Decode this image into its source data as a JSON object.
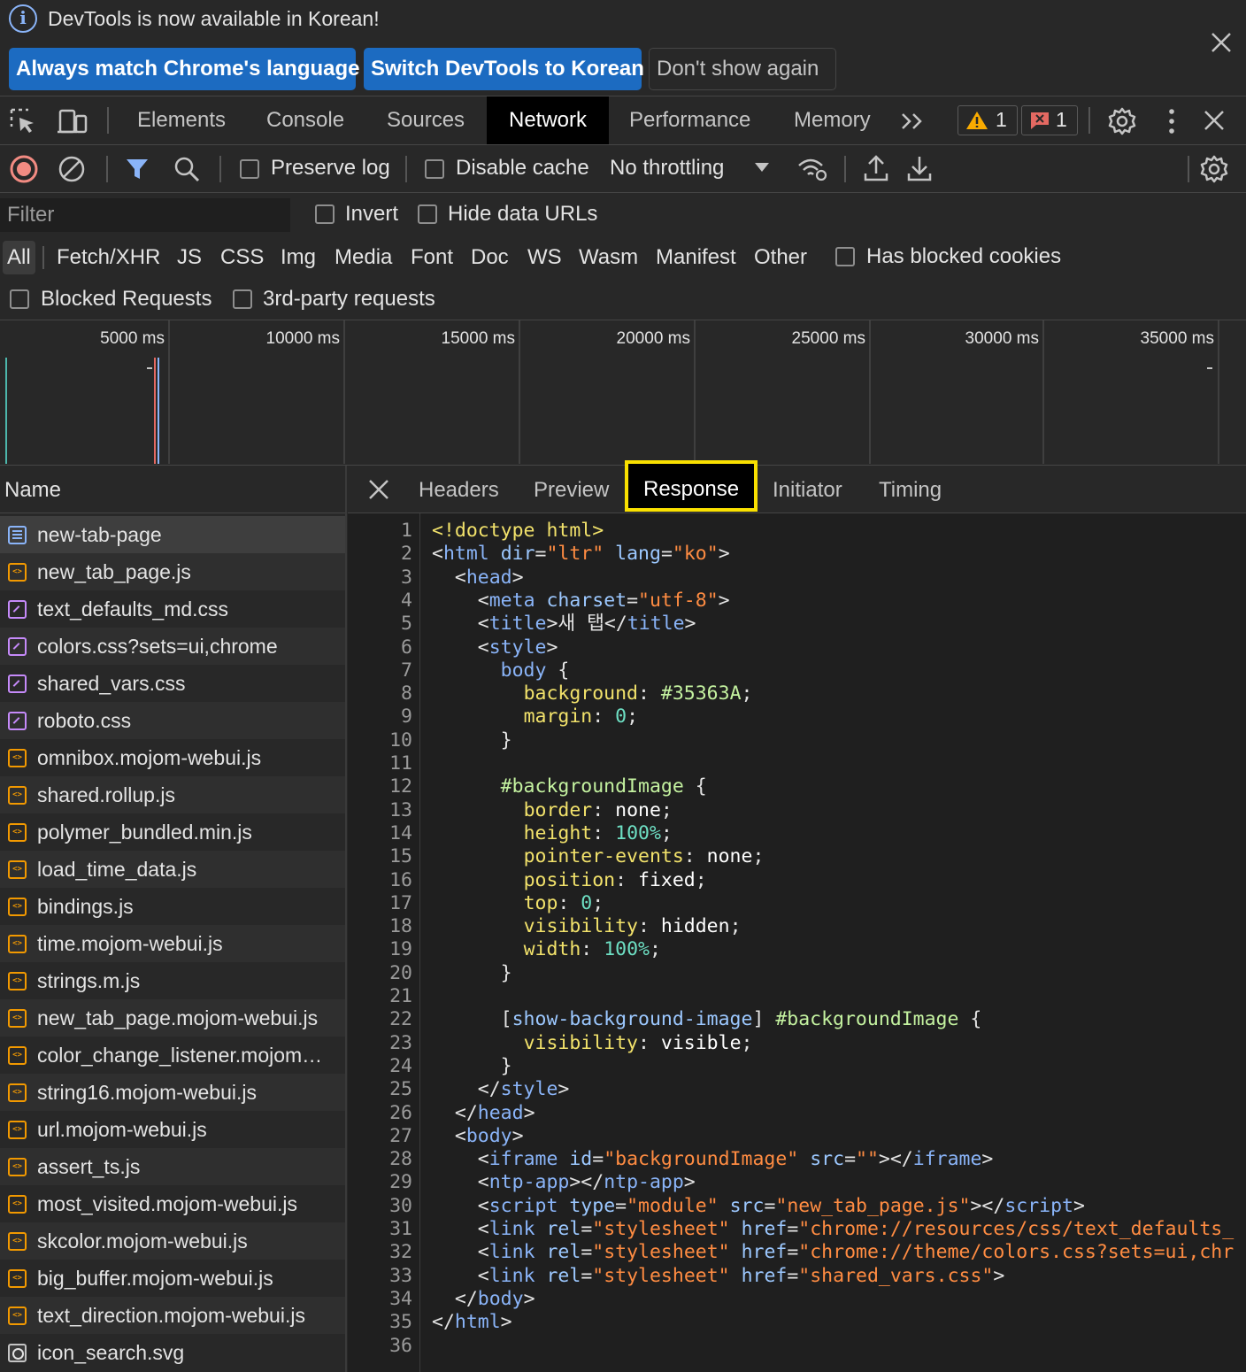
{
  "infobar": {
    "message": "DevTools is now available in Korean!",
    "buttons": [
      "Always match Chrome's language",
      "Switch DevTools to Korean",
      "Don't show again"
    ]
  },
  "main_tabs": [
    "Elements",
    "Console",
    "Sources",
    "Network",
    "Performance",
    "Memory"
  ],
  "active_main_tab": "Network",
  "badges": {
    "warnings": "1",
    "errors": "1"
  },
  "toolbar": {
    "preserve_log": "Preserve log",
    "disable_cache": "Disable cache",
    "throttling": "No throttling"
  },
  "filter": {
    "placeholder": "Filter",
    "invert": "Invert",
    "hide_data_urls": "Hide data URLs",
    "types": [
      "All",
      "Fetch/XHR",
      "JS",
      "CSS",
      "Img",
      "Media",
      "Font",
      "Doc",
      "WS",
      "Wasm",
      "Manifest",
      "Other"
    ],
    "has_blocked_cookies": "Has blocked cookies",
    "blocked_requests": "Blocked Requests",
    "third_party": "3rd-party requests"
  },
  "overview": {
    "ticks": [
      "5000 ms",
      "10000 ms",
      "15000 ms",
      "20000 ms",
      "25000 ms",
      "30000 ms",
      "35000 ms"
    ]
  },
  "requests": {
    "header": "Name",
    "items": [
      {
        "name": "new-tab-page",
        "type": "doc"
      },
      {
        "name": "new_tab_page.js",
        "type": "js"
      },
      {
        "name": "text_defaults_md.css",
        "type": "css"
      },
      {
        "name": "colors.css?sets=ui,chrome",
        "type": "css"
      },
      {
        "name": "shared_vars.css",
        "type": "css"
      },
      {
        "name": "roboto.css",
        "type": "css"
      },
      {
        "name": "omnibox.mojom-webui.js",
        "type": "js"
      },
      {
        "name": "shared.rollup.js",
        "type": "js"
      },
      {
        "name": "polymer_bundled.min.js",
        "type": "js"
      },
      {
        "name": "load_time_data.js",
        "type": "js"
      },
      {
        "name": "bindings.js",
        "type": "js"
      },
      {
        "name": "time.mojom-webui.js",
        "type": "js"
      },
      {
        "name": "strings.m.js",
        "type": "js"
      },
      {
        "name": "new_tab_page.mojom-webui.js",
        "type": "js"
      },
      {
        "name": "color_change_listener.mojom…",
        "type": "js"
      },
      {
        "name": "string16.mojom-webui.js",
        "type": "js"
      },
      {
        "name": "url.mojom-webui.js",
        "type": "js"
      },
      {
        "name": "assert_ts.js",
        "type": "js"
      },
      {
        "name": "most_visited.mojom-webui.js",
        "type": "js"
      },
      {
        "name": "skcolor.mojom-webui.js",
        "type": "js"
      },
      {
        "name": "big_buffer.mojom-webui.js",
        "type": "js"
      },
      {
        "name": "text_direction.mojom-webui.js",
        "type": "js"
      },
      {
        "name": "icon_search.svg",
        "type": "img"
      }
    ]
  },
  "detail_tabs": [
    "Headers",
    "Preview",
    "Response",
    "Initiator",
    "Timing"
  ],
  "active_detail_tab": "Response",
  "response_lines": [
    [
      [
        "d",
        "<!doctype html>"
      ]
    ],
    [
      [
        "p",
        "<"
      ],
      [
        "t",
        "html"
      ],
      [
        "p",
        " "
      ],
      [
        "a",
        "dir"
      ],
      [
        "p",
        "="
      ],
      [
        "v",
        "\"ltr\""
      ],
      [
        "p",
        " "
      ],
      [
        "a",
        "lang"
      ],
      [
        "p",
        "="
      ],
      [
        "v",
        "\"ko\""
      ],
      [
        "p",
        ">"
      ]
    ],
    [
      [
        "p",
        "  <"
      ],
      [
        "t",
        "head"
      ],
      [
        "p",
        ">"
      ]
    ],
    [
      [
        "p",
        "    <"
      ],
      [
        "t",
        "meta"
      ],
      [
        "p",
        " "
      ],
      [
        "a",
        "charset"
      ],
      [
        "p",
        "="
      ],
      [
        "v",
        "\"utf-8\""
      ],
      [
        "p",
        ">"
      ]
    ],
    [
      [
        "p",
        "    <"
      ],
      [
        "t",
        "title"
      ],
      [
        "p",
        ">새 탭</"
      ],
      [
        "t",
        "title"
      ],
      [
        "p",
        ">"
      ]
    ],
    [
      [
        "p",
        "    <"
      ],
      [
        "t",
        "style"
      ],
      [
        "p",
        ">"
      ]
    ],
    [
      [
        "p",
        "      "
      ],
      [
        "t",
        "body"
      ],
      [
        "p",
        " {"
      ]
    ],
    [
      [
        "p",
        "        "
      ],
      [
        "pr",
        "background"
      ],
      [
        "p",
        ": "
      ],
      [
        "selg",
        "#35363A"
      ],
      [
        "p",
        ";"
      ]
    ],
    [
      [
        "p",
        "        "
      ],
      [
        "pr",
        "margin"
      ],
      [
        "p",
        ": "
      ],
      [
        "n",
        "0"
      ],
      [
        "p",
        ";"
      ]
    ],
    [
      [
        "p",
        "      }"
      ]
    ],
    [
      [
        "p",
        ""
      ]
    ],
    [
      [
        "p",
        "      "
      ],
      [
        "selg",
        "#backgroundImage"
      ],
      [
        "p",
        " {"
      ]
    ],
    [
      [
        "p",
        "        "
      ],
      [
        "pr",
        "border"
      ],
      [
        "p",
        ": "
      ],
      [
        "cv",
        "none"
      ],
      [
        "p",
        ";"
      ]
    ],
    [
      [
        "p",
        "        "
      ],
      [
        "pr",
        "height"
      ],
      [
        "p",
        ": "
      ],
      [
        "n",
        "100%"
      ],
      [
        "p",
        ";"
      ]
    ],
    [
      [
        "p",
        "        "
      ],
      [
        "pr",
        "pointer-events"
      ],
      [
        "p",
        ": "
      ],
      [
        "cv",
        "none"
      ],
      [
        "p",
        ";"
      ]
    ],
    [
      [
        "p",
        "        "
      ],
      [
        "pr",
        "position"
      ],
      [
        "p",
        ": "
      ],
      [
        "cv",
        "fixed"
      ],
      [
        "p",
        ";"
      ]
    ],
    [
      [
        "p",
        "        "
      ],
      [
        "pr",
        "top"
      ],
      [
        "p",
        ": "
      ],
      [
        "n",
        "0"
      ],
      [
        "p",
        ";"
      ]
    ],
    [
      [
        "p",
        "        "
      ],
      [
        "pr",
        "visibility"
      ],
      [
        "p",
        ": "
      ],
      [
        "cv",
        "hidden"
      ],
      [
        "p",
        ";"
      ]
    ],
    [
      [
        "p",
        "        "
      ],
      [
        "pr",
        "width"
      ],
      [
        "p",
        ": "
      ],
      [
        "n",
        "100%"
      ],
      [
        "p",
        ";"
      ]
    ],
    [
      [
        "p",
        "      }"
      ]
    ],
    [
      [
        "p",
        ""
      ]
    ],
    [
      [
        "p",
        "      ["
      ],
      [
        "a",
        "show-background-image"
      ],
      [
        "p",
        "] "
      ],
      [
        "selg",
        "#backgroundImage"
      ],
      [
        "p",
        " {"
      ]
    ],
    [
      [
        "p",
        "        "
      ],
      [
        "pr",
        "visibility"
      ],
      [
        "p",
        ": "
      ],
      [
        "cv",
        "visible"
      ],
      [
        "p",
        ";"
      ]
    ],
    [
      [
        "p",
        "      }"
      ]
    ],
    [
      [
        "p",
        "    </"
      ],
      [
        "t",
        "style"
      ],
      [
        "p",
        ">"
      ]
    ],
    [
      [
        "p",
        "  </"
      ],
      [
        "t",
        "head"
      ],
      [
        "p",
        ">"
      ]
    ],
    [
      [
        "p",
        "  <"
      ],
      [
        "t",
        "body"
      ],
      [
        "p",
        ">"
      ]
    ],
    [
      [
        "p",
        "    <"
      ],
      [
        "t",
        "iframe"
      ],
      [
        "p",
        " "
      ],
      [
        "a",
        "id"
      ],
      [
        "p",
        "="
      ],
      [
        "v",
        "\"backgroundImage\""
      ],
      [
        "p",
        " "
      ],
      [
        "a",
        "src"
      ],
      [
        "p",
        "="
      ],
      [
        "v",
        "\"\""
      ],
      [
        "p",
        "></"
      ],
      [
        "t",
        "iframe"
      ],
      [
        "p",
        ">"
      ]
    ],
    [
      [
        "p",
        "    <"
      ],
      [
        "t",
        "ntp-app"
      ],
      [
        "p",
        "></"
      ],
      [
        "t",
        "ntp-app"
      ],
      [
        "p",
        ">"
      ]
    ],
    [
      [
        "p",
        "    <"
      ],
      [
        "t",
        "script"
      ],
      [
        "p",
        " "
      ],
      [
        "a",
        "type"
      ],
      [
        "p",
        "="
      ],
      [
        "v",
        "\"module\""
      ],
      [
        "p",
        " "
      ],
      [
        "a",
        "src"
      ],
      [
        "p",
        "="
      ],
      [
        "v",
        "\"new_tab_page.js\""
      ],
      [
        "p",
        "></"
      ],
      [
        "t",
        "script"
      ],
      [
        "p",
        ">"
      ]
    ],
    [
      [
        "p",
        "    <"
      ],
      [
        "t",
        "link"
      ],
      [
        "p",
        " "
      ],
      [
        "a",
        "rel"
      ],
      [
        "p",
        "="
      ],
      [
        "v",
        "\"stylesheet\""
      ],
      [
        "p",
        " "
      ],
      [
        "a",
        "href"
      ],
      [
        "p",
        "="
      ],
      [
        "v",
        "\"chrome://resources/css/text_defaults_"
      ]
    ],
    [
      [
        "p",
        "    <"
      ],
      [
        "t",
        "link"
      ],
      [
        "p",
        " "
      ],
      [
        "a",
        "rel"
      ],
      [
        "p",
        "="
      ],
      [
        "v",
        "\"stylesheet\""
      ],
      [
        "p",
        " "
      ],
      [
        "a",
        "href"
      ],
      [
        "p",
        "="
      ],
      [
        "v",
        "\"chrome://theme/colors.css?sets=ui,chr"
      ]
    ],
    [
      [
        "p",
        "    <"
      ],
      [
        "t",
        "link"
      ],
      [
        "p",
        " "
      ],
      [
        "a",
        "rel"
      ],
      [
        "p",
        "="
      ],
      [
        "v",
        "\"stylesheet\""
      ],
      [
        "p",
        " "
      ],
      [
        "a",
        "href"
      ],
      [
        "p",
        "="
      ],
      [
        "v",
        "\"shared_vars.css\""
      ],
      [
        "p",
        ">"
      ]
    ],
    [
      [
        "p",
        "  </"
      ],
      [
        "t",
        "body"
      ],
      [
        "p",
        ">"
      ]
    ],
    [
      [
        "p",
        "</"
      ],
      [
        "t",
        "html"
      ],
      [
        "p",
        ">"
      ]
    ],
    [
      [
        "p",
        ""
      ]
    ]
  ],
  "colors": {
    "accent_blue": "#8ab4f8",
    "record_red": "#f28b82",
    "highlight_yellow": "#f9e000",
    "primary_button": "#1c6bc1"
  }
}
